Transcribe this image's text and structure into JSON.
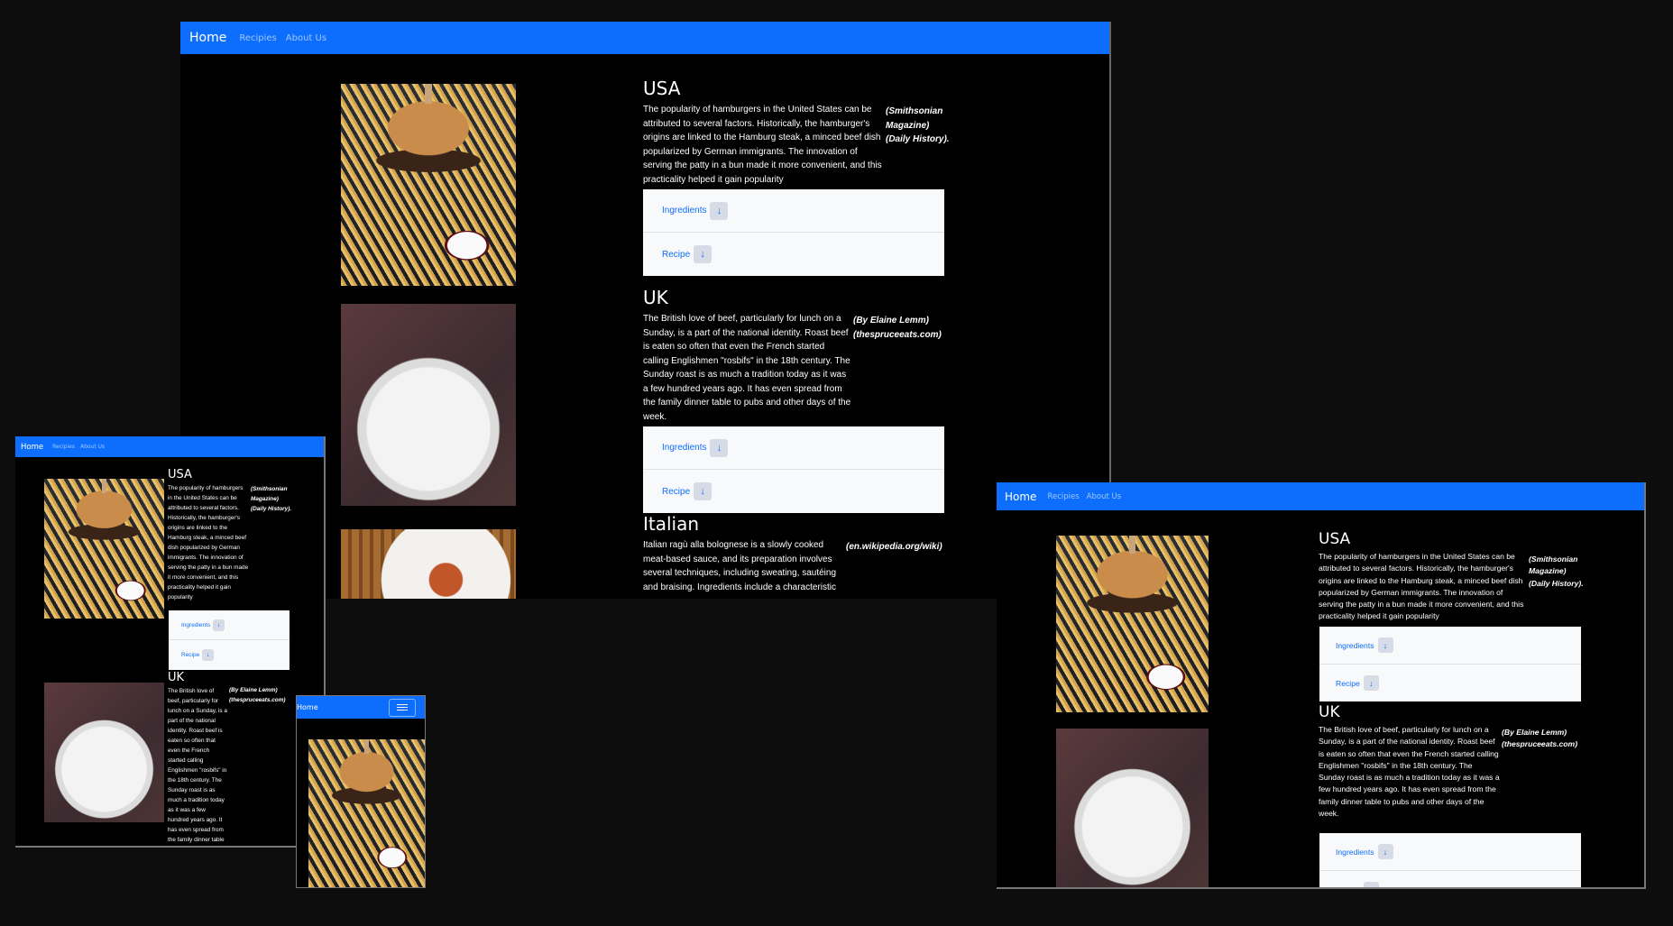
{
  "nav": {
    "brand": "Home",
    "recipes": "Recipies",
    "about": "About Us"
  },
  "sections": {
    "usa": {
      "title": "USA",
      "text": "The popularity of hamburgers in the United States can be attributed to several factors. Historically, the hamburger's origins are linked to the Hamburg steak, a minced beef dish popularized by German immigrants. The innovation of serving the patty in a bun made it more convenient, and this practicality helped it gain popularity",
      "source": "(Smithsonian Magazine) (Daily History)."
    },
    "uk": {
      "title": "UK",
      "text": "The British love of beef, particularly for lunch on a Sunday, is a part of the national identity. Roast beef is eaten so often that even the French started calling Englishmen \"rosbifs\" in the 18th century. The Sunday roast is as much a tradition today as it was a few hundred years ago. It has even spread from the family dinner table to pubs and other days of the week.",
      "source": "(By Elaine Lemm) (thespruceeats.com)"
    },
    "italian": {
      "title": "Italian",
      "text": "Italian ragù alla bolognese is a slowly cooked meat-based sauce, and its preparation involves several techniques, including sweating, sautéing and braising. Ingredients include a characteristic",
      "source": "(en.wikipedia.org/wiki)"
    }
  },
  "accordion": {
    "ingredients": "Ingredients",
    "recipe": "Recipe",
    "arrow": "↓"
  },
  "icons": {
    "menu": "hamburger-menu-icon",
    "arrow": "arrow-down-icon"
  },
  "colors": {
    "primary": "#0d6efd",
    "background": "#000000"
  }
}
